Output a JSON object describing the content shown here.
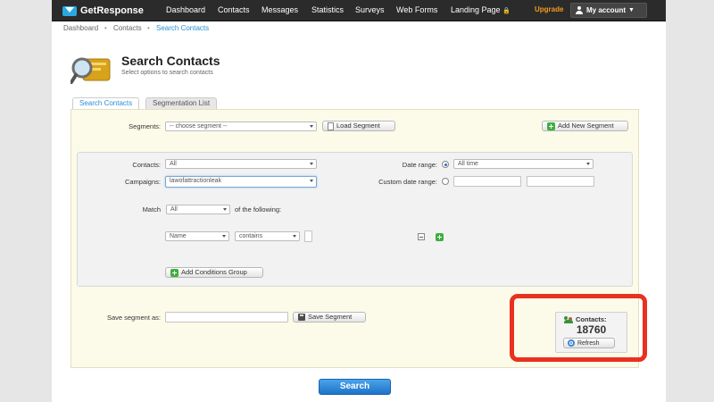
{
  "brand": {
    "name": "GetResponse"
  },
  "nav": {
    "items": [
      "Dashboard",
      "Contacts",
      "Messages",
      "Statistics",
      "Surveys",
      "Web Forms",
      "Landing Page"
    ],
    "upgrade": "Upgrade",
    "account": "My account"
  },
  "breadcrumb": {
    "home": "Dashboard",
    "section": "Contacts",
    "current": "Search Contacts"
  },
  "header": {
    "title": "Search Contacts",
    "subtitle": "Select options to search contacts"
  },
  "tabs": [
    "Search Contacts",
    "Segmentation List"
  ],
  "segments": {
    "label": "Segments:",
    "select_value": "-- choose segment --",
    "load_button": "Load Segment",
    "add_button": "Add New Segment"
  },
  "filters": {
    "contacts_label": "Contacts:",
    "contacts_value": "All",
    "campaigns_label": "Campaigns:",
    "campaigns_value": "lawofattractionleak",
    "date_range_label": "Date range:",
    "date_range_value": "All time",
    "custom_date_label": "Custom date range:",
    "match_label": "Match",
    "match_value": "All",
    "match_suffix": "of the following:",
    "condition_field": "Name",
    "condition_operator": "contains",
    "add_group_button": "Add Conditions Group"
  },
  "save": {
    "label": "Save segment as:",
    "button": "Save Segment"
  },
  "contacts_box": {
    "label": "Contacts:",
    "count": "18760",
    "refresh": "Refresh"
  },
  "search_button": "Search",
  "colors": {
    "nav_bg": "#2b2b2b",
    "accent": "#2a8fd6",
    "upgrade": "#f39c1f",
    "highlight": "#e8311f",
    "add_green": "#3fae3f"
  }
}
